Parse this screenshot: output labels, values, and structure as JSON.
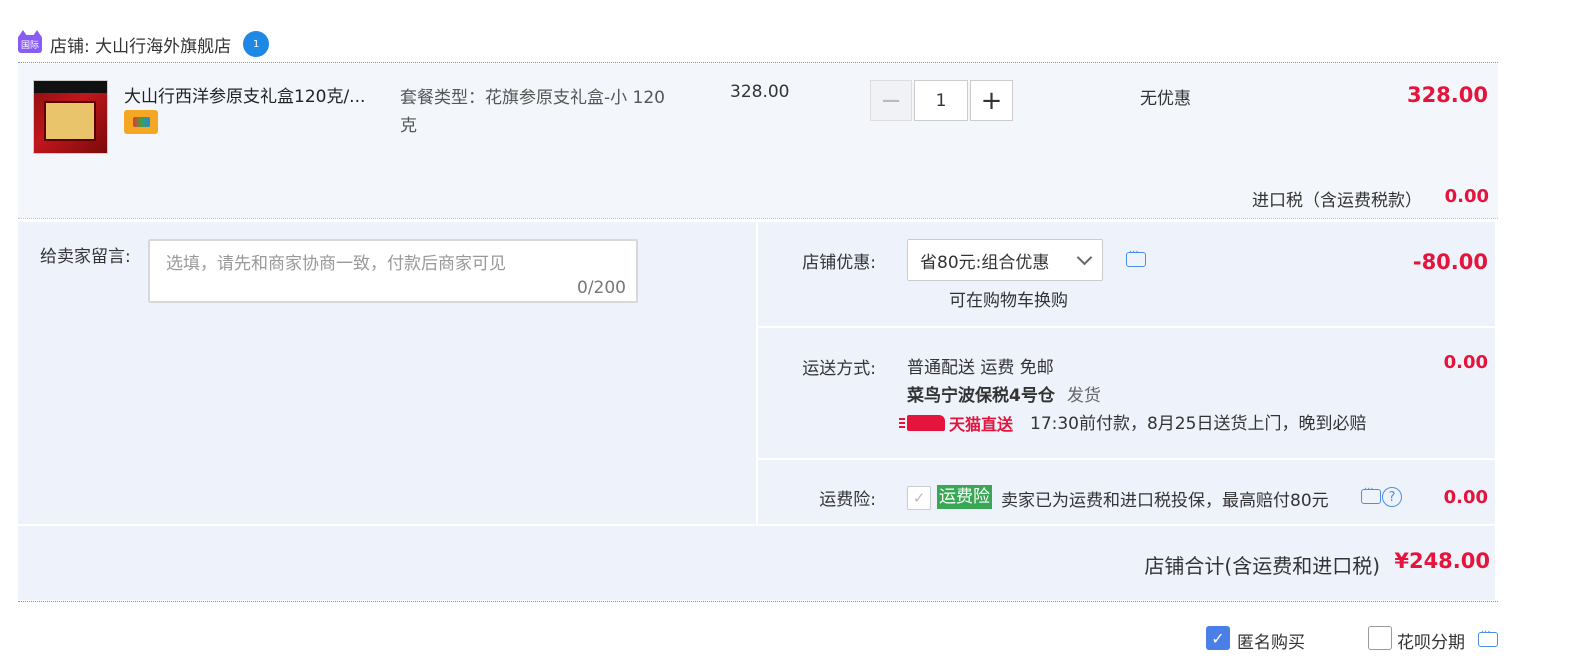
{
  "shop": {
    "badge_text": "国际",
    "name_label": "店铺: 大山行海外旗舰店",
    "ww_icon_text": "1"
  },
  "item": {
    "title": "大山行西洋参原支礼盒120克/...",
    "sku": "套餐类型：花旗参原支礼盒-小 120克",
    "unit_price": "328.00",
    "quantity": "1",
    "minus": "−",
    "plus": "+",
    "discount": "无优惠",
    "total": "328.00",
    "tax_label": "进口税（含运费税款）",
    "tax_value": "0.00"
  },
  "message": {
    "label": "给卖家留言:",
    "placeholder": "选填，请先和商家协商一致，付款后商家可见",
    "count": "0/200"
  },
  "coupon": {
    "label": "店铺优惠:",
    "selected": "省80元:组合优惠",
    "sub": "可在购物车换购",
    "amount": "-80.00"
  },
  "shipping": {
    "label": "运送方式:",
    "line1": "普通配送 运费 免邮",
    "warehouse": "菜鸟宁波保税4号仓",
    "warehouse_suffix": "发货",
    "brand": "天猫直送",
    "note": "17:30前付款，8月25日送货上门，晚到必赔",
    "amount": "0.00"
  },
  "insurance": {
    "label": "运费险:",
    "tag": "运费险",
    "text": "卖家已为运费和进口税投保，最高赔付80元",
    "help": "?",
    "amount": "0.00"
  },
  "summary": {
    "label": "店铺合计(含运费和进口税)",
    "value": "¥248.00"
  },
  "options": {
    "anonymous_label": "匿名购买",
    "anonymous_checked": true,
    "huabei_label": "花呗分期",
    "huabei_checked": false
  },
  "colors": {
    "price_red": "#e4143c",
    "link_blue": "#4a90e2",
    "panel_bg": "#eef3fb",
    "insurance_green": "#3aa757"
  }
}
